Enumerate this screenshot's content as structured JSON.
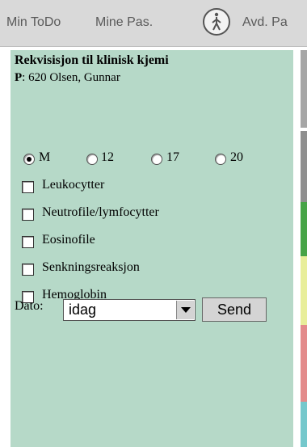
{
  "nav": {
    "items": [
      "Min ToDo",
      "Mine Pas.",
      "Avd. Pa"
    ]
  },
  "form": {
    "title": "Rekvisisjon til klinisk kjemi",
    "patient_prefix": "P",
    "patient_text": ": 620 Olsen, Gunnar",
    "radios": [
      {
        "label": "M",
        "selected": true
      },
      {
        "label": "12",
        "selected": false
      },
      {
        "label": "17",
        "selected": false
      },
      {
        "label": "20",
        "selected": false
      }
    ],
    "checks": [
      "Leukocytter",
      "Neutrofile/lymfocytter",
      "Eosinofile",
      "Senkningsreaksjon",
      "Hemoglobin"
    ],
    "date_label": "Dato:",
    "date_value": "idag",
    "send_label": "Send"
  },
  "colors": {
    "panel": "#b6d9c8",
    "strip": [
      "#9c9c9c",
      "#8c8c8c",
      "#47a447",
      "#e8ee9a",
      "#e38b8b",
      "#75c8cc"
    ]
  }
}
